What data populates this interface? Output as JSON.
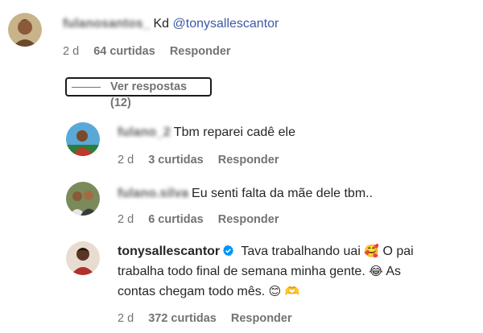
{
  "comments": {
    "top": {
      "text": "Kd",
      "mention": "@tonysallescantor",
      "time": "2 d",
      "likes": "64 curtidas",
      "reply": "Responder",
      "view_replies": "Ver respostas (12)"
    },
    "replies": [
      {
        "text": "Tbm reparei cadê ele",
        "time": "2 d",
        "likes": "3 curtidas",
        "reply": "Responder"
      },
      {
        "text": "Eu senti falta da mãe dele tbm..",
        "time": "2 d",
        "likes": "6 curtidas",
        "reply": "Responder"
      },
      {
        "username": "tonysallescantor",
        "line1": "Tava trabalhando uai",
        "line1_emoji": "🥰",
        "line1_end": "O pai",
        "line2": "trabalha todo final de semana minha gente.",
        "line2_emoji": "😂",
        "line2_end": "As",
        "line3": "contas chegam todo mês.",
        "line3_emoji1": "😊",
        "line3_emoji2": "🫶",
        "time": "2 d",
        "likes": "372 curtidas",
        "reply": "Responder"
      }
    ]
  },
  "colors": {
    "mention": "#3b5aa5",
    "meta": "#737373",
    "verified": "#0095f6"
  }
}
